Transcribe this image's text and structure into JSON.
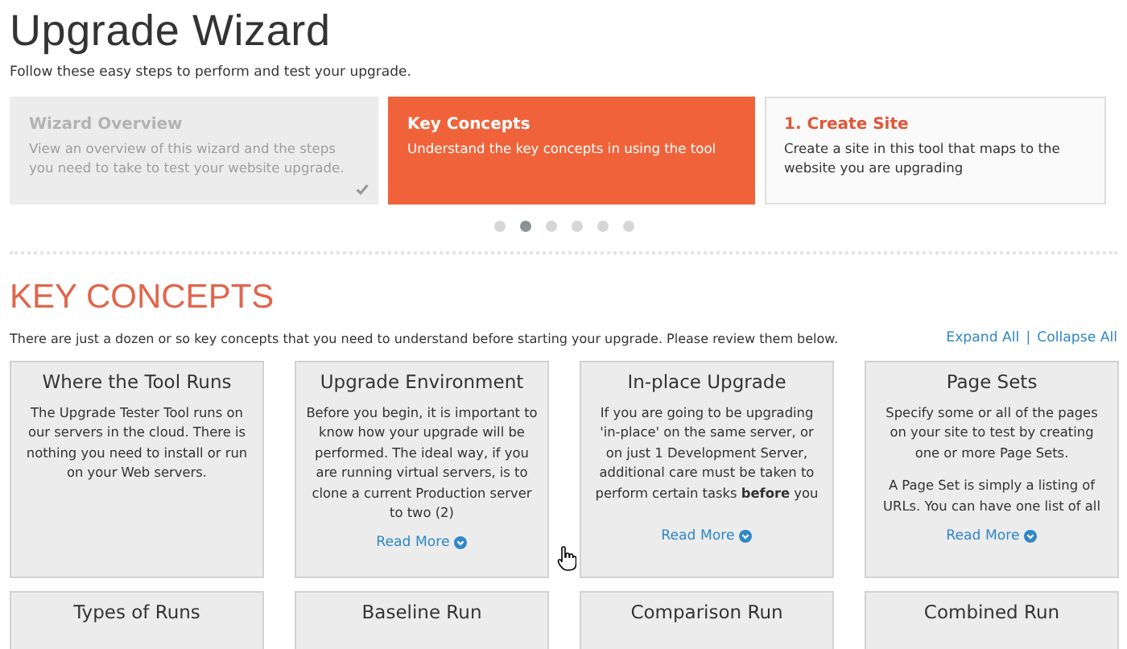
{
  "title": "Upgrade Wizard",
  "subtitle": "Follow these easy steps to perform and test your upgrade.",
  "steps": [
    {
      "title": "Wizard Overview",
      "text": "View an overview of this wizard and the steps you need to take to test your website upgrade.",
      "completed": true,
      "selected": false
    },
    {
      "title": "Key Concepts",
      "text": "Understand the key concepts in using the tool",
      "completed": false,
      "selected": true
    },
    {
      "title": "1. Create Site",
      "text": "Create a site in this tool that maps to the website you are upgrading",
      "completed": false,
      "selected": false
    }
  ],
  "pager": [
    {
      "selected": false
    },
    {
      "selected": true
    },
    {
      "selected": false
    },
    {
      "selected": false
    },
    {
      "selected": false
    },
    {
      "selected": false
    }
  ],
  "section": {
    "heading": "KEY CONCEPTS",
    "intro": "There are just a dozen or so key concepts that you need to understand before starting your upgrade. Please review them below.",
    "expand_all": "Expand All",
    "separator": "|",
    "collapse_all": "Collapse All"
  },
  "concepts": [
    {
      "title": "Where the Tool Runs",
      "paragraphs": [
        "The Upgrade Tester Tool runs on our servers in the cloud. There is nothing you need to install or run on your Web servers."
      ]
    },
    {
      "title": "Upgrade Environment",
      "paragraphs": [
        "Before you begin, it is important to know how your upgrade will be performed. The ideal way, if you are running virtual servers, is to clone a current Production server to two (2)"
      ],
      "read_more": "Read More"
    },
    {
      "title": "In-place Upgrade",
      "paragraphs": [
        "If you are going to be upgrading 'in-place' on the same server, or on just 1 Development Server, additional care must be taken to perform certain tasks **before** you"
      ],
      "read_more": "Read More"
    },
    {
      "title": "Page Sets",
      "paragraphs": [
        "Specify some or all of the pages on your site to test by creating one or more Page Sets.",
        "A Page Set is simply a listing of URLs. You can have one list of all"
      ],
      "read_more": "Read More"
    },
    {
      "title": "Types of Runs"
    },
    {
      "title": "Baseline Run"
    },
    {
      "title": "Comparison Run"
    },
    {
      "title": "Combined Run"
    }
  ]
}
